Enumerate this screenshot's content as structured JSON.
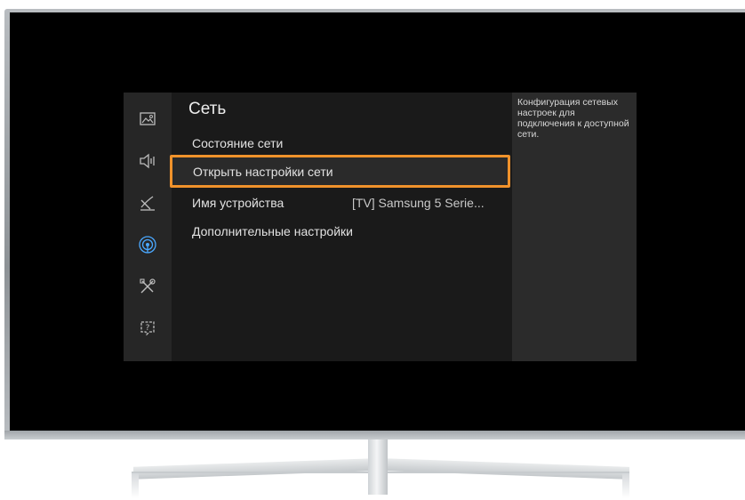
{
  "menu": {
    "title": "Сеть",
    "items": [
      {
        "label": "Состояние сети",
        "value": ""
      },
      {
        "label": "Открыть настройки сети",
        "value": ""
      },
      {
        "label": "Имя устройства",
        "value": "[TV] Samsung 5 Serie..."
      },
      {
        "label": "Дополнительные настройки",
        "value": ""
      }
    ],
    "focused_index": 1
  },
  "sidebar": {
    "icons": [
      "picture-icon",
      "sound-icon",
      "broadcast-icon",
      "network-icon",
      "tools-icon",
      "support-icon"
    ],
    "active_index": 3
  },
  "description": {
    "text": "Конфигурация сетевых настроек для подключения к доступной сети."
  },
  "colors": {
    "focus": "#f0922b",
    "active_icon": "#4aa8ff",
    "screen": "#000000"
  }
}
